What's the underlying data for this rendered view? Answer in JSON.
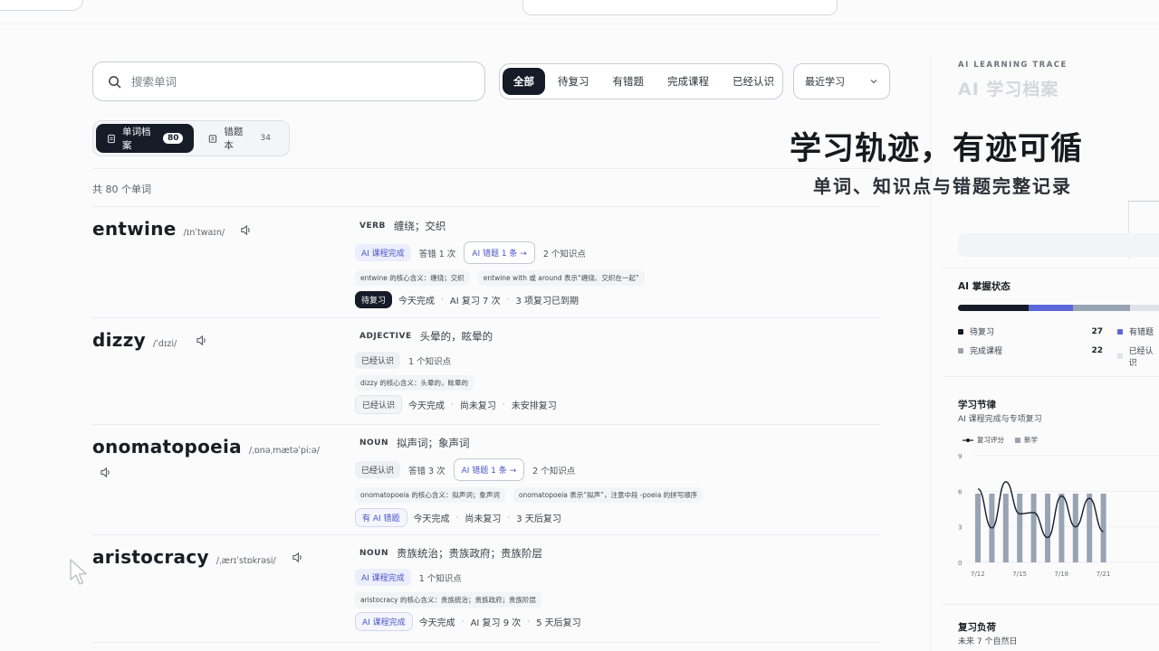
{
  "search": {
    "placeholder": "搜索单词"
  },
  "filters": [
    "全部",
    "待复习",
    "有错题",
    "完成课程",
    "已经认识"
  ],
  "sort": {
    "value": "最近学习"
  },
  "trace": {
    "label": "AI LEARNING TRACE",
    "title": "AI 学习档案"
  },
  "tabs": [
    {
      "label": "单词档案",
      "count": "80"
    },
    {
      "label": "错题本",
      "count": "34"
    }
  ],
  "total": "共 80 个单词",
  "hero": {
    "line1": "学习轨迹，有迹可循",
    "line2": "单词、知识点与错题完整记录"
  },
  "words": [
    {
      "word": "entwine",
      "phonetic": "/ɪnˈtwaɪn/",
      "pos": "VERB",
      "def": "缠绕；交织",
      "status_chip": "AI 课程完成",
      "wrong": "答错 1 次",
      "ai_wrong": "AI 错题 1 条 →",
      "points": "2 个知识点",
      "notes": [
        "entwine 的核心含义：缠绕；交织",
        "entwine with 或 around 表示“缠绕、交织在一起”"
      ],
      "badge": "待复习",
      "meta1": "今天完成",
      "meta2": "AI 复习 7 次",
      "meta3": "3 项复习已到期"
    },
    {
      "word": "dizzy",
      "phonetic": "/ˈdɪzi/",
      "pos": "ADJECTIVE",
      "def": "头晕的，眩晕的",
      "status_chip": "已经认识",
      "points": "1 个知识点",
      "notes": [
        "dizzy 的核心含义：头晕的，眩晕的"
      ],
      "badge": "已经认识",
      "meta1": "今天完成",
      "meta2": "尚未复习",
      "meta3": "未安排复习"
    },
    {
      "word": "onomatopoeia",
      "phonetic": "/ˌɒnəˌmætəˈpiːə/",
      "pos": "NOUN",
      "def": "拟声词；象声词",
      "status_chip": "已经认识",
      "wrong": "答错 3 次",
      "ai_wrong": "AI 错题 1 条 →",
      "points": "2 个知识点",
      "notes": [
        "onomatopoeia 的核心含义：拟声词；象声词",
        "onomatopoeia 表示“拟声”，注意中段 -poeia 的拼写顺序"
      ],
      "badge": "有 AI 错题",
      "meta1": "今天完成",
      "meta2": "尚未复习",
      "meta3": "3 天后复习"
    },
    {
      "word": "aristocracy",
      "phonetic": "/ˌærɪˈstɒkrəsi/",
      "pos": "NOUN",
      "def": "贵族统治；贵族政府；贵族阶层",
      "status_chip": "AI 课程完成",
      "points": "1 个知识点",
      "notes": [
        "aristocracy 的核心含义：贵族统治；贵族政府；贵族阶层"
      ],
      "badge": "AI 课程完成",
      "meta1": "今天完成",
      "meta2": "AI 复习 9 次",
      "meta3": "5 天后复习"
    }
  ],
  "mastery": {
    "title": "AI 掌握状态",
    "segments": [
      {
        "name": "待复习",
        "value": 27,
        "color": "#151c28"
      },
      {
        "name": "有错题",
        "value": 17,
        "color": "#5b67d6"
      },
      {
        "name": "完成课程",
        "value": 22,
        "color": "#98a3b4"
      },
      {
        "name": "已经认识",
        "value": 14,
        "color": "#dfe2e8"
      }
    ],
    "legend": {
      "review": "待复习",
      "review_n": "27",
      "wrong": "有错题",
      "done": "完成课程",
      "done_n": "22",
      "known": "已经认识"
    }
  },
  "rhythm": {
    "title": "学习节律",
    "subtitle": "AI 课程完成与专项复习",
    "legend_line": "复习评分",
    "legend_bar": "新学"
  },
  "chart_data": {
    "type": "bar",
    "x": [
      "7/12",
      "7/13",
      "7/14",
      "7/15",
      "7/16",
      "7/17",
      "7/18",
      "7/19",
      "7/20",
      "7/21"
    ],
    "xticks": [
      "7/12",
      "7/15",
      "7/18",
      "7/21"
    ],
    "yticks": [
      "0",
      "3",
      "6",
      "9"
    ],
    "ylim": [
      0,
      9
    ],
    "series": [
      {
        "name": "新学",
        "type": "bar",
        "values": [
          5.8,
          5.8,
          5.8,
          5.8,
          5.8,
          5.8,
          5.8,
          5.8,
          5.8,
          5.8
        ]
      },
      {
        "name": "复习评分",
        "type": "line",
        "values": [
          6.2,
          2.9,
          6.8,
          4.1,
          4.2,
          2.1,
          5.6,
          3.0,
          5.4,
          2.6
        ]
      }
    ]
  },
  "load": {
    "title": "复习负荷",
    "subtitle": "未来 7 个自然日"
  },
  "colors": {
    "dark": "#151c28",
    "accent": "#5b67d6",
    "gray": "#98a3b4"
  }
}
